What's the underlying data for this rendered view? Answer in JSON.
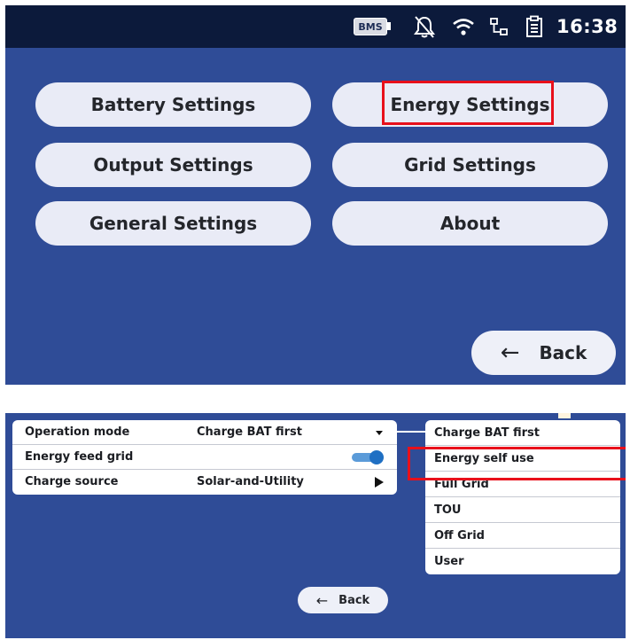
{
  "top_screen": {
    "status_bar": {
      "bms_label": "BMS",
      "time": "16:38",
      "icons": [
        "bms-battery-icon",
        "alarm-off-icon",
        "wifi-icon",
        "network-icon",
        "clipboard-icon"
      ]
    },
    "menu": [
      {
        "label": "Battery Settings",
        "highlighted": false
      },
      {
        "label": "Energy Settings",
        "highlighted": true
      },
      {
        "label": "Output Settings",
        "highlighted": false
      },
      {
        "label": "Grid Settings",
        "highlighted": false
      },
      {
        "label": "General Settings",
        "highlighted": false
      },
      {
        "label": "About",
        "highlighted": false
      }
    ],
    "back_label": "Back"
  },
  "bottom_screen": {
    "settings": [
      {
        "label": "Operation mode",
        "value": "Charge BAT first",
        "control": "dropdown"
      },
      {
        "label": "Energy feed grid",
        "value": "",
        "control": "toggle",
        "on": true
      },
      {
        "label": "Charge source",
        "value": "Solar-and-Utility",
        "control": "submenu"
      }
    ],
    "operation_mode_options": [
      {
        "label": "Charge BAT first",
        "highlighted": false
      },
      {
        "label": "Energy self use",
        "highlighted": true
      },
      {
        "label": "Full Grid",
        "highlighted": false
      },
      {
        "label": "TOU",
        "highlighted": false
      },
      {
        "label": "Off Grid",
        "highlighted": false
      },
      {
        "label": "User",
        "highlighted": false
      }
    ],
    "back_label": "Back"
  },
  "colors": {
    "background": "#2f4c97",
    "status_bar": "#0c1a3b",
    "button": "#e9ebf6",
    "highlight": "#e8101b",
    "toggle_on": "#1f6fc3"
  }
}
